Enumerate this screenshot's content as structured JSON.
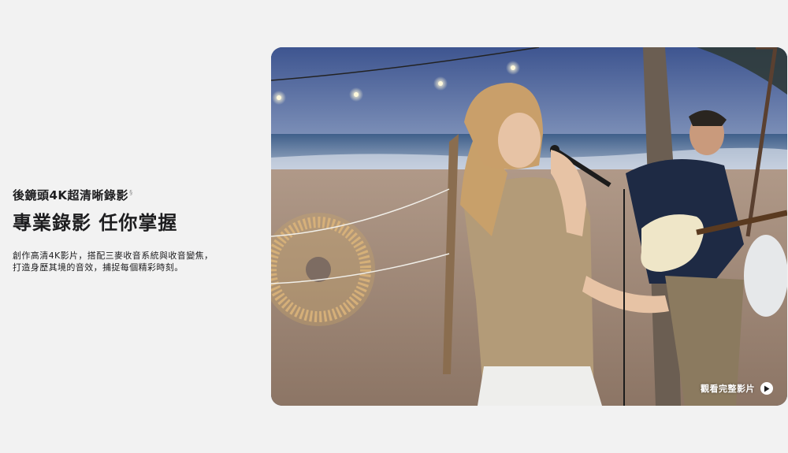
{
  "feature": {
    "eyebrow": "後鏡頭4K超清晰錄影",
    "footnote_mark": "§",
    "headline": "專業錄影 任你掌握",
    "body_lines": [
      "創作高清4K影片，搭配三麥收音系統與收音變焦，",
      "打造身歷其境的音效，捕捉每個精彩時刻。"
    ]
  },
  "media": {
    "watch_label": "觀看完整影片",
    "play_icon": "play-icon"
  }
}
